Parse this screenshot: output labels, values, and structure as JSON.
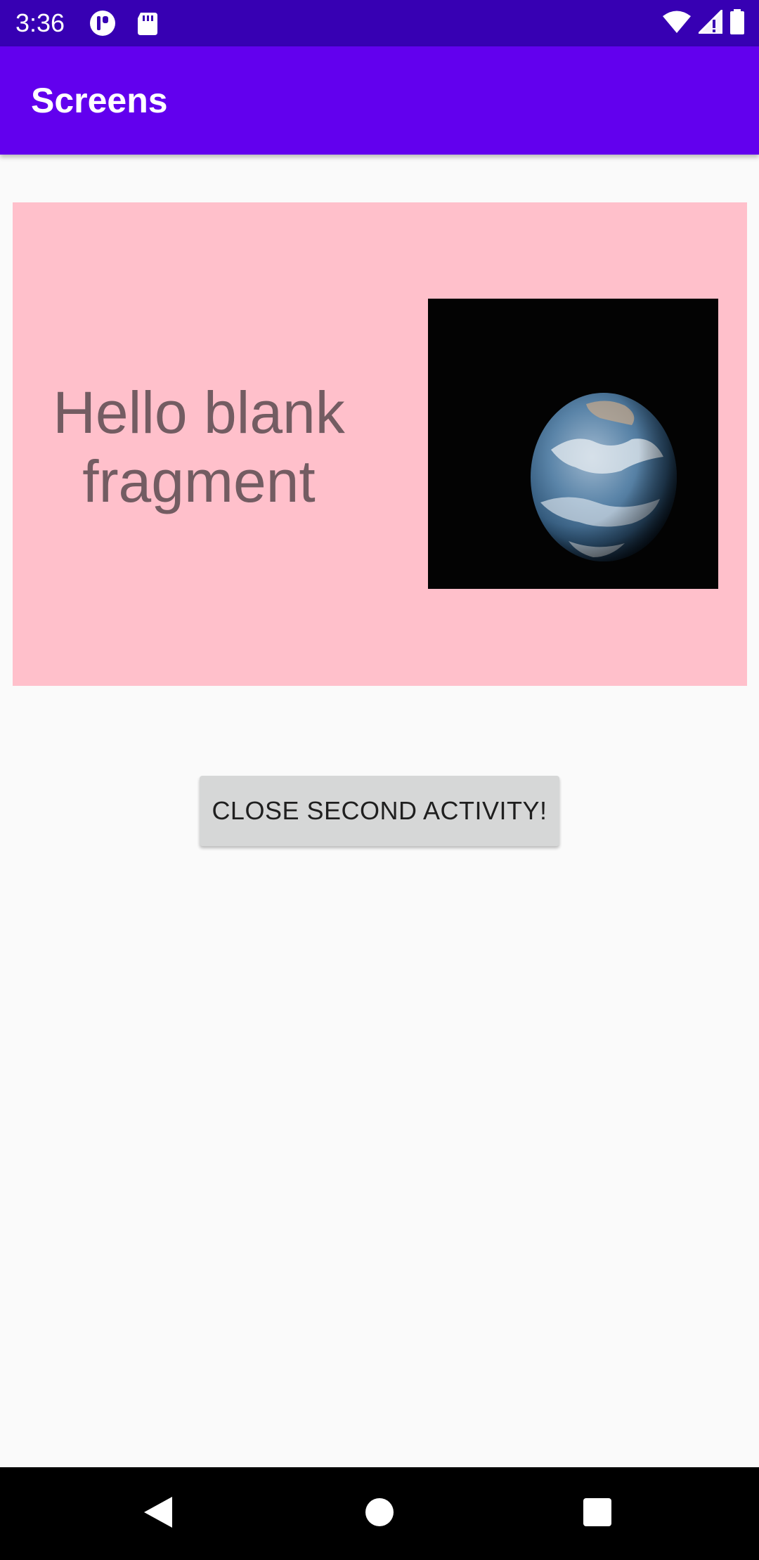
{
  "status_bar": {
    "time": "3:36",
    "icons": [
      "app-notification-icon",
      "sd-card-icon",
      "wifi-icon",
      "cell-signal-icon",
      "battery-icon"
    ]
  },
  "app_bar": {
    "title": "Screens"
  },
  "fragment": {
    "text": "Hello blank fragment",
    "image": "earth-image",
    "background": "#ffc0cb"
  },
  "actions": {
    "close_label": "CLOSE SECOND ACTIVITY!"
  },
  "nav_bar": {
    "icons": [
      "back-icon",
      "home-icon",
      "recents-icon"
    ]
  },
  "colors": {
    "status_bar": "#3700b3",
    "primary": "#6200ee",
    "button": "#d6d7d7",
    "fragment_text": "#735c62"
  }
}
